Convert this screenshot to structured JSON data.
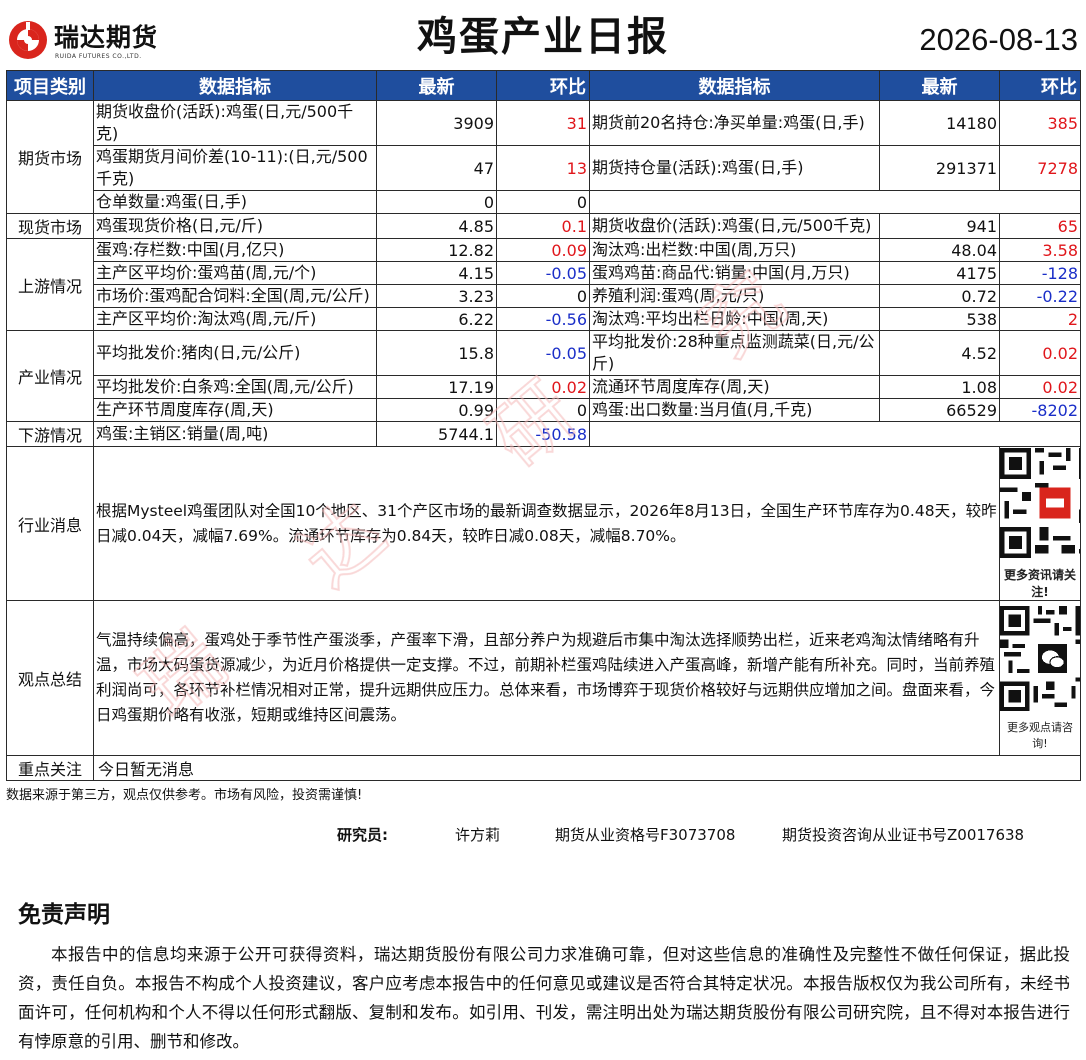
{
  "header": {
    "logo_cn": "瑞达期货",
    "logo_en": "RUIDA FUTURES CO.,LTD.",
    "title": "鸡蛋产业日报",
    "date": "2026-08-13"
  },
  "table_headers": {
    "category": "项目类别",
    "indicator": "数据指标",
    "latest": "最新",
    "change": "环比",
    "indicator2": "数据指标",
    "latest2": "最新",
    "change2": "环比"
  },
  "sections": {
    "futures": {
      "label": "期货市场",
      "rows": [
        {
          "ind": "期货收盘价(活跃):鸡蛋(日,元/500千克)",
          "val": "3909",
          "chg": "31",
          "ind2": "期货前20名持仓:净买单量:鸡蛋(日,手)",
          "val2": "14180",
          "chg2": "385"
        },
        {
          "ind": "鸡蛋期货月间价差(10-11):(日,元/500千克)",
          "val": "47",
          "chg": "13",
          "ind2": "期货持仓量(活跃):鸡蛋(日,手)",
          "val2": "291371",
          "chg2": "7278"
        },
        {
          "ind": "仓单数量:鸡蛋(日,手)",
          "val": "0",
          "chg": "0"
        }
      ]
    },
    "spot": {
      "label": "现货市场",
      "rows": [
        {
          "ind": "鸡蛋现货价格(日,元/斤)",
          "val": "4.85",
          "chg": "0.1",
          "ind2": "期货收盘价(活跃):鸡蛋(日,元/500千克)",
          "val2": "941",
          "chg2": "65"
        }
      ]
    },
    "upstream": {
      "label": "上游情况",
      "rows": [
        {
          "ind": "蛋鸡:存栏数:中国(月,亿只)",
          "val": "12.82",
          "chg": "0.09",
          "ind2": "淘汰鸡:出栏数:中国(周,万只)",
          "val2": "48.04",
          "chg2": "3.58"
        },
        {
          "ind": "主产区平均价:蛋鸡苗(周,元/个)",
          "val": "4.15",
          "chg": "-0.05",
          "ind2": "蛋鸡鸡苗:商品代:销量:中国(月,万只)",
          "val2": "4175",
          "chg2": "-128"
        },
        {
          "ind": "市场价:蛋鸡配合饲料:全国(周,元/公斤)",
          "val": "3.23",
          "chg": "0",
          "ind2": "养殖利润:蛋鸡(周,元/只)",
          "val2": "0.72",
          "chg2": "-0.22"
        },
        {
          "ind": "主产区平均价:淘汰鸡(周,元/斤)",
          "val": "6.22",
          "chg": "-0.56",
          "ind2": "淘汰鸡:平均出栏日龄:中国(周,天)",
          "val2": "538",
          "chg2": "2"
        }
      ]
    },
    "industry": {
      "label": "产业情况",
      "rows": [
        {
          "ind": "平均批发价:猪肉(日,元/公斤)",
          "val": "15.8",
          "chg": "-0.05",
          "ind2": "平均批发价:28种重点监测蔬菜(日,元/公斤)",
          "val2": "4.52",
          "chg2": "0.02"
        },
        {
          "ind": "平均批发价:白条鸡:全国(周,元/公斤)",
          "val": "17.19",
          "chg": "0.02",
          "ind2": "流通环节周度库存(周,天)",
          "val2": "1.08",
          "chg2": "0.02"
        },
        {
          "ind": "生产环节周度库存(周,天)",
          "val": "0.99",
          "chg": "0",
          "ind2": "鸡蛋:出口数量:当月值(月,千克)",
          "val2": "66529",
          "chg2": "-8202"
        }
      ]
    },
    "downstream": {
      "label": "下游情况",
      "rows": [
        {
          "ind": "鸡蛋:主销区:销量(周,吨)",
          "val": "5744.1",
          "chg": "-50.58"
        }
      ]
    }
  },
  "news": {
    "label": "行业消息",
    "text": "根据Mysteel鸡蛋团队对全国10个地区、31个产区市场的最新调查数据显示，2026年8月13日，全国生产环节库存为0.48天，较昨日减0.04天，减幅7.69%。流通环节库存为0.84天，较昨日减0.08天，减幅8.70%。",
    "qr_caption": "更多资讯请关注!"
  },
  "summary": {
    "label": "观点总结",
    "text": "气温持续偏高，蛋鸡处于季节性产蛋淡季，产蛋率下滑，且部分养户为规避后市集中淘汰选择顺势出栏，近来老鸡淘汰情绪略有升温，市场大码蛋货源减少，为近月价格提供一定支撑。不过，前期补栏蛋鸡陆续进入产蛋高峰，新增产能有所补充。同时，当前养殖利润尚可，各环节补栏情况相对正常，提升远期供应压力。总体来看，市场博弈于现货价格较好与远期供应增加之间。盘面来看，今日鸡蛋期价略有收涨，短期或维持区间震荡。",
    "qr_caption": "更多观点请咨询!"
  },
  "focus": {
    "label": "重点关注",
    "text": "今日暂无消息"
  },
  "footer": {
    "note": "数据来源于第三方，观点仅供参考。市场有风险，投资需谨慎!",
    "researcher_label": "研究员:",
    "researcher_name": "许方莉",
    "license1": "期货从业资格号F3073708",
    "license2": "期货投资咨询从业证书号Z0017638"
  },
  "disclaimer": {
    "title": "免责声明",
    "text": "本报告中的信息均来源于公开可获得资料，瑞达期货股份有限公司力求准确可靠，但对这些信息的准确性及完整性不做任何保证，据此投资，责任自负。本报告不构成个人投资建议，客户应考虑本报告中的任何意见或建议是否符合其特定状况。本报告版权仅为我公司所有，未经书面许可，任何机构和个人不得以任何形式翻版、复制和发布。如引用、刊发，需注明出处为瑞达期货股份有限公司研究院，且不得对本报告进行有悖原意的引用、删节和修改。"
  },
  "watermark": "瑞达研究",
  "colors": {
    "header_bg": "#1f4e9e",
    "positive": "#e0161b",
    "negative": "#1a2ec8",
    "brand_red": "#d9251d"
  }
}
